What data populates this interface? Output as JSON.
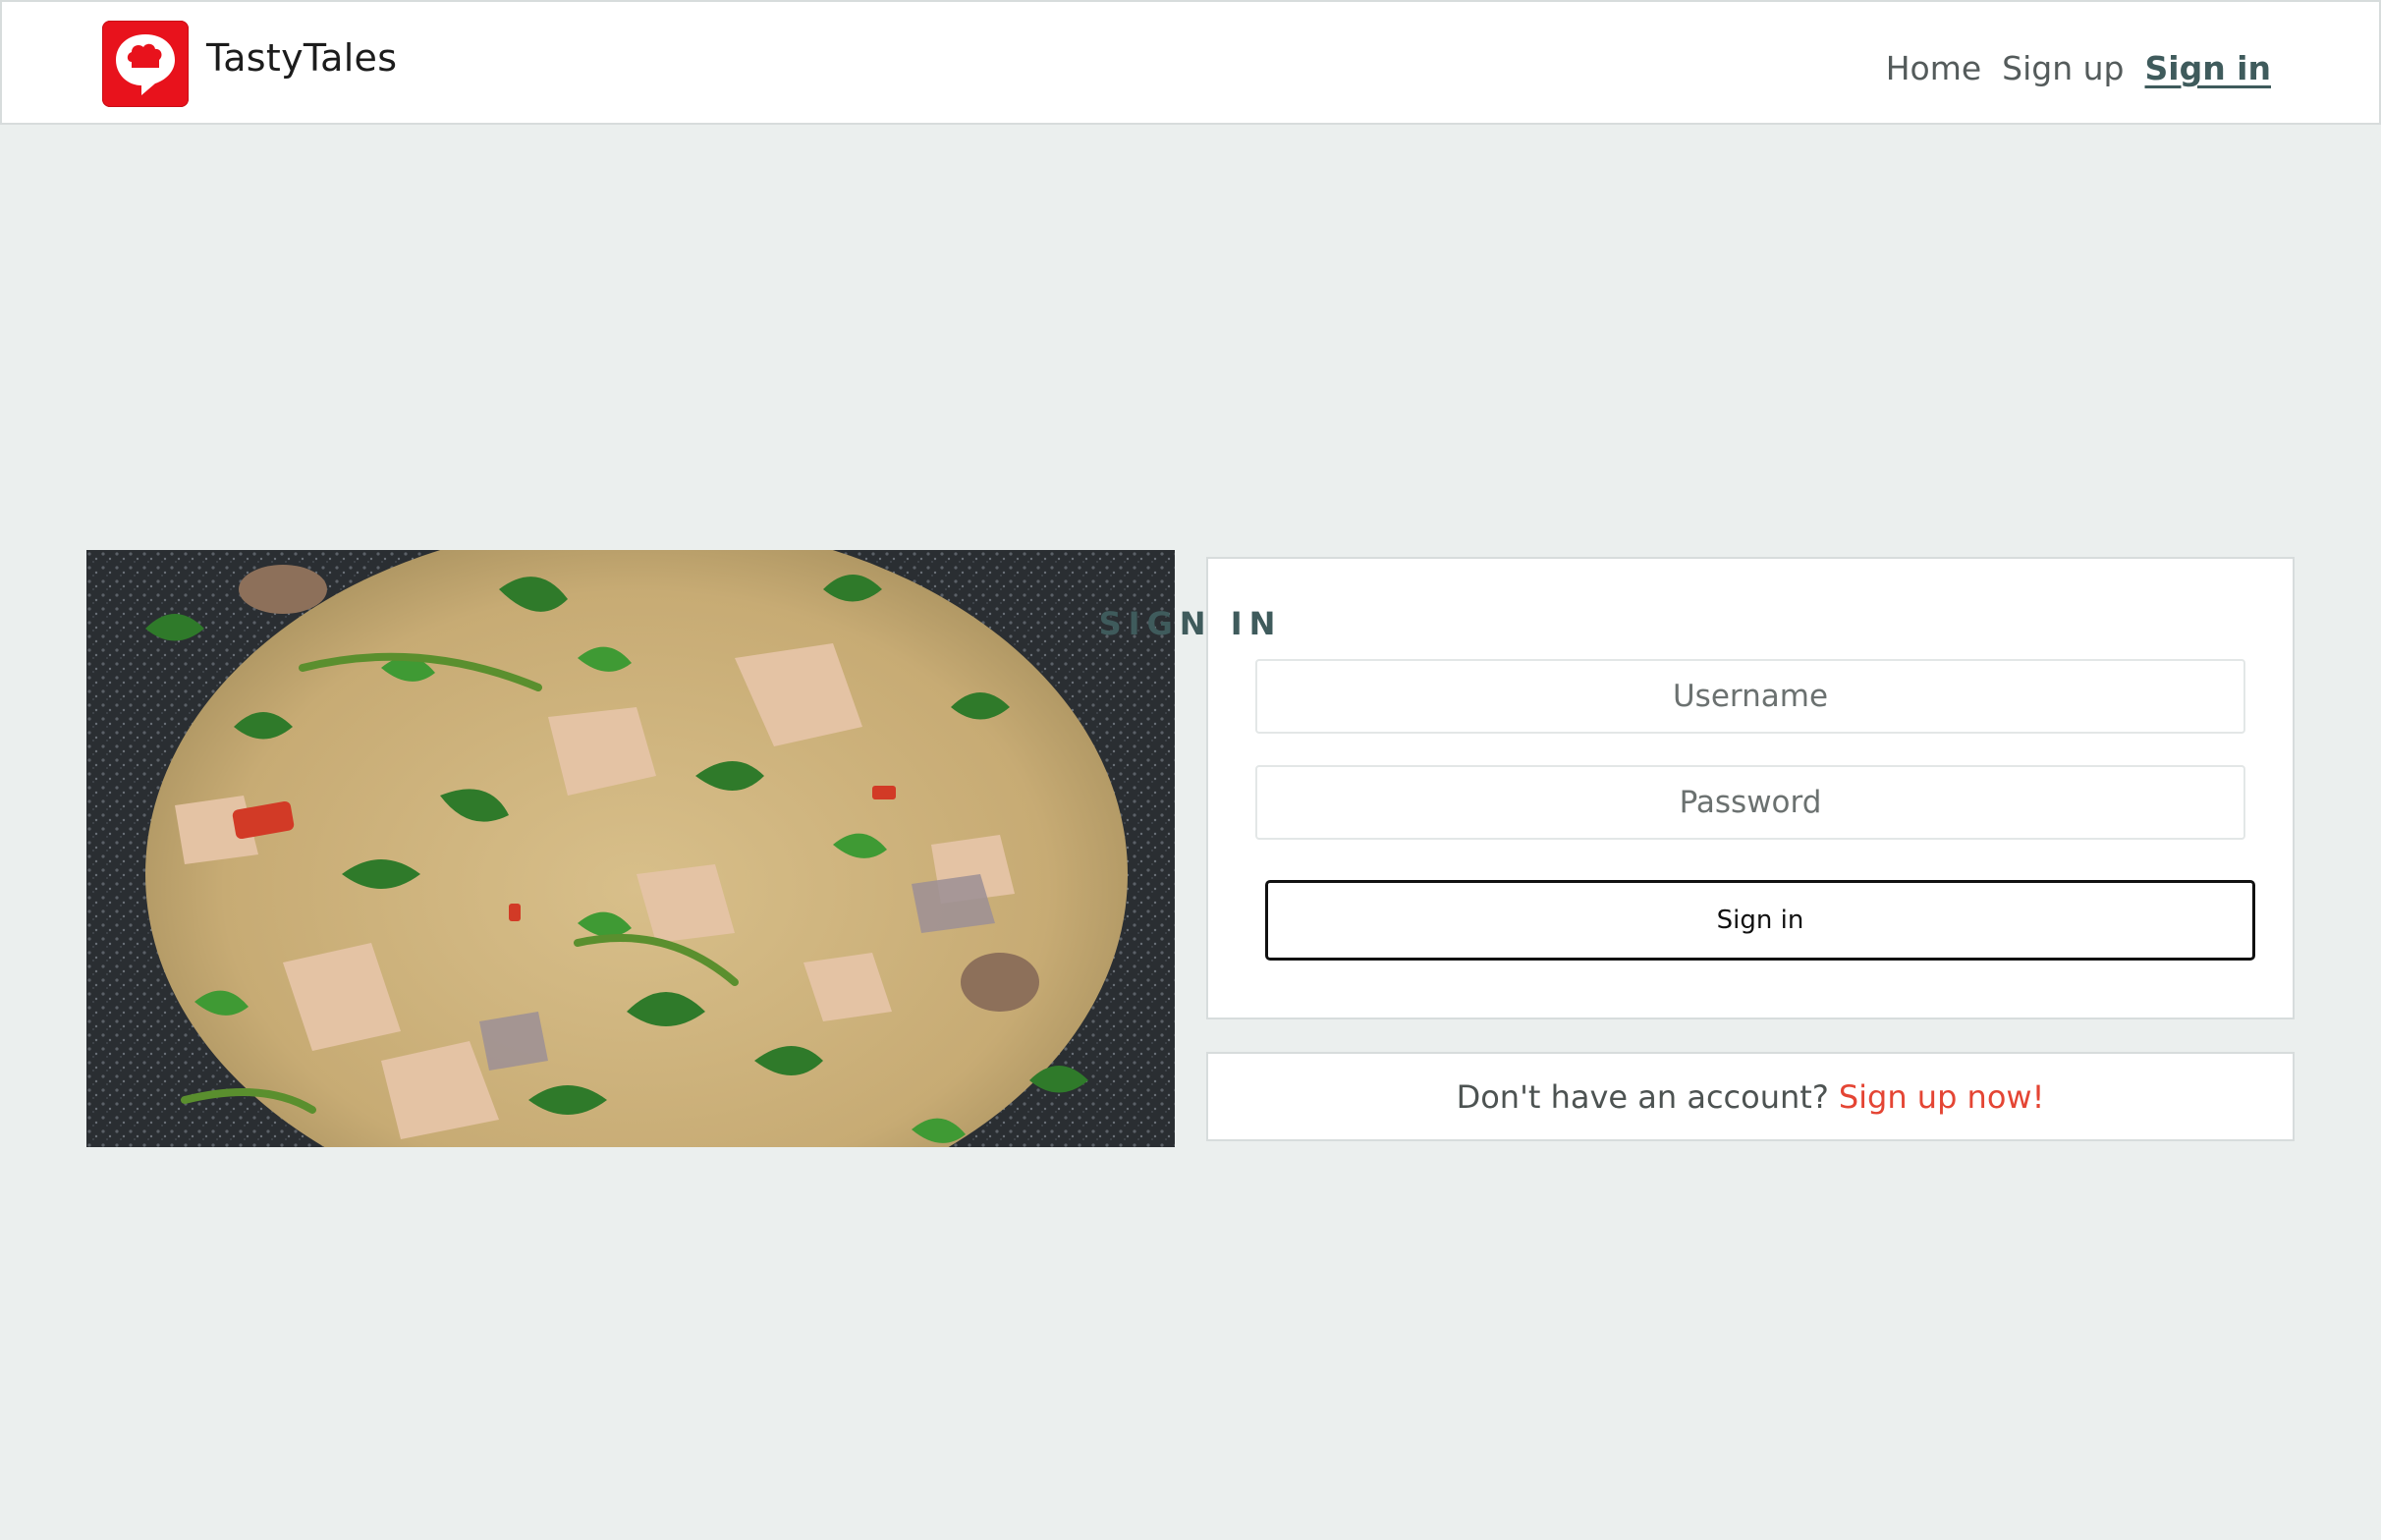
{
  "brand": {
    "name": "TastyTales",
    "logo_icon": "chef-hat-chat-icon",
    "color": "#e8121c"
  },
  "nav": {
    "items": [
      {
        "label": "Home",
        "active": false
      },
      {
        "label": "Sign up",
        "active": false
      },
      {
        "label": "Sign in",
        "active": true
      }
    ]
  },
  "hero": {
    "alt": "Creamy chicken curry with spinach and herbs in a pan"
  },
  "signin": {
    "title": "SIGN IN",
    "username_placeholder": "Username",
    "password_placeholder": "Password",
    "submit_label": "Sign in"
  },
  "signup_prompt": {
    "text": "Don't have an account?",
    "link": "Sign up now!"
  },
  "colors": {
    "accent": "#3f5b5c",
    "link": "#e44534",
    "background": "#ebefee"
  }
}
